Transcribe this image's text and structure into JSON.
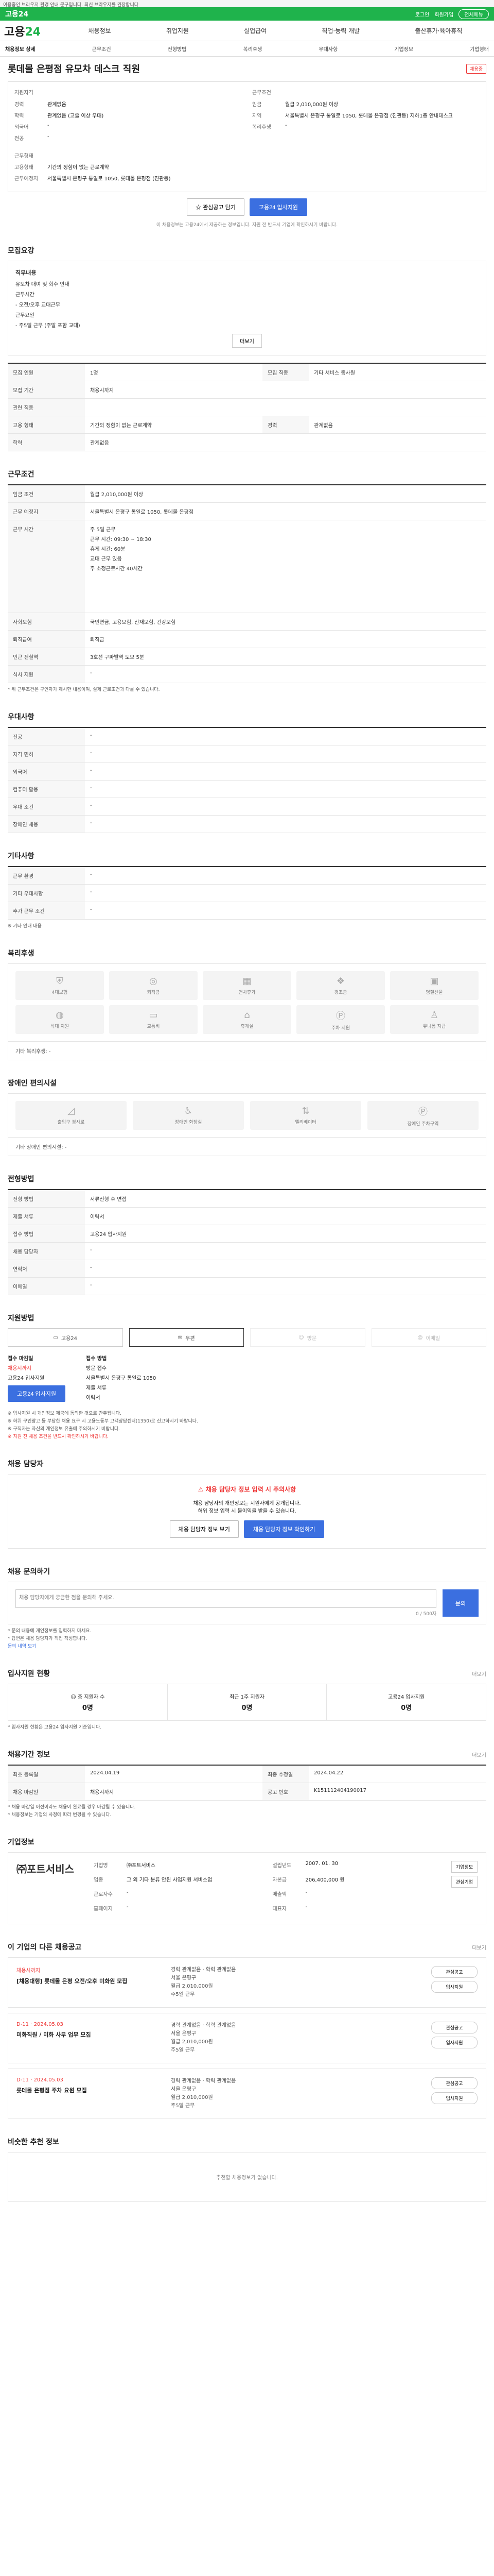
{
  "top_notice": "이용중인 브라우저 환경 안내 문구입니다. 최신 브라우저를 권장합니다",
  "gnb": {
    "logo": "고용24",
    "links": [
      "로그인",
      "회원가입",
      "전체메뉴"
    ]
  },
  "header": {
    "brand_a": "고용",
    "brand_b": "24",
    "nav": [
      "채용정보",
      "취업지원",
      "실업급여",
      "직업·능력 개발",
      "출산휴가·육아휴직"
    ]
  },
  "subnav": [
    "채용정보 상세",
    "근무조건",
    "전형방법",
    "복리후생",
    "우대사항",
    "기업정보",
    "기업형태"
  ],
  "job": {
    "title": "롯데몰 은평점 유모차 데스크 직원",
    "status_badge": "채용중",
    "summary_left_head": "지원자격",
    "summary_left": [
      {
        "k": "경력",
        "v": "관계없음"
      },
      {
        "k": "학력",
        "v": "관계없음 (고졸 이상 우대)"
      },
      {
        "k": "외국어",
        "v": "-"
      },
      {
        "k": "전공",
        "v": "-"
      }
    ],
    "summary_left2": [
      {
        "k": "근무형태",
        "v": ""
      },
      {
        "k": "고용형태",
        "v": "기간의 정함이 없는 근로계약"
      },
      {
        "k": "근무예정지",
        "v": "서울특별시 은평구 통일로 1050, 롯데몰 은평점 (진관동)"
      }
    ],
    "summary_right_head": "근무조건",
    "summary_right": [
      {
        "k": "임금",
        "v": "월급 2,010,000원 이상"
      },
      {
        "k": "지역",
        "v": "서울특별시 은평구 통일로 1050, 롯데몰 은평점 (진관동) 지하1층 안내데스크"
      },
      {
        "k": "복리후생",
        "v": "-"
      }
    ],
    "btn_interest": "관심공고 담기",
    "btn_apply": "고용24 입사지원",
    "notice": "이 채용정보는 고용24에서 제공하는 정보입니다. 지원 전 반드시 기업에 확인하시기 바랍니다."
  },
  "recruit": {
    "section": "모집요강",
    "head": "직무내용",
    "lines": [
      "유모차 대여 및 회수 안내",
      "",
      "근무시간",
      "- 오전/오후 교대근무",
      "",
      "근무요일",
      "- 주5일 근무 (주말 포함 교대)"
    ],
    "more": "더보기"
  },
  "detail_rows": [
    {
      "th": "모집 인원",
      "td": "1명",
      "th2": "모집 직종",
      "td2": "기타 서비스 종사원"
    },
    {
      "th": "모집 기간",
      "td": "채용시까지",
      "th2": "",
      "td2": ""
    },
    {
      "th": "관련 직종",
      "td": "",
      "th2": "",
      "td2": ""
    },
    {
      "th": "고용 형태",
      "td": "기간의 정함이 없는 근로계약",
      "th2": "경력",
      "td2": "관계없음"
    },
    {
      "th": "학력",
      "td": "관계없음",
      "th2": "",
      "td2": ""
    }
  ],
  "conditions": {
    "section": "근무조건",
    "wage_th": "임금 조건",
    "wage": "월급 2,010,000원 이상",
    "area_th": "근무 예정지",
    "area": "서울특별시 은평구 통일로 1050, 롯데몰 은평점",
    "time_th": "근무 시간",
    "time_lines": [
      "주 5일 근무",
      "근무 시간: 09:30 ~ 18:30",
      "휴게 시간: 60분",
      "교대 근무 있음",
      "주 소정근로시간 40시간"
    ],
    "insurance_th": "사회보험",
    "insurance": "국민연금, 고용보험, 산재보험, 건강보험",
    "retire_th": "퇴직급여",
    "retire": "퇴직금",
    "subway_th": "인근 전철역",
    "subway": "3호선 구파발역 도보 5분",
    "food_th": "식사 지원",
    "food": "-",
    "note": "* 위 근무조건은 구인자가 제시한 내용이며, 실제 근로조건과 다를 수 있습니다."
  },
  "qualifications": {
    "section": "우대사항",
    "rows": [
      {
        "th": "전공",
        "td": "-"
      },
      {
        "th": "자격 면허",
        "td": "-"
      },
      {
        "th": "외국어",
        "td": "-"
      },
      {
        "th": "컴퓨터 활용",
        "td": "-"
      },
      {
        "th": "우대 조건",
        "td": "-"
      },
      {
        "th": "장애인 채용",
        "td": "-"
      }
    ]
  },
  "etc": {
    "section": "기타사항",
    "rows": [
      {
        "th": "근무 환경",
        "td": "-"
      },
      {
        "th": "기타 우대사항",
        "td": "-"
      },
      {
        "th": "추가 근무 조건",
        "td": "-"
      }
    ],
    "note": "※ 기타 안내 내용"
  },
  "welfare": {
    "section": "복리후생",
    "items": [
      "4대보험",
      "퇴직금",
      "연차휴가",
      "경조금",
      "명절선물",
      "식대 지원",
      "교통비",
      "휴게실",
      "주차 지원",
      "유니폼 지급"
    ],
    "note": "기타 복리후생: -"
  },
  "disabled": {
    "section": "장애인 편의시설",
    "items": [
      "출입구 경사로",
      "장애인 화장실",
      "엘리베이터",
      "장애인 주차구역"
    ],
    "note": "기타 장애인 편의시설: -"
  },
  "selection": {
    "section": "전형방법",
    "rows": [
      {
        "th": "전형 방법",
        "td": "서류전형 후 면접"
      },
      {
        "th": "제출 서류",
        "td": "이력서"
      },
      {
        "th": "접수 방법",
        "td": "고용24 입사지원"
      },
      {
        "th": "채용 담당자",
        "td": "-"
      },
      {
        "th": "연락처",
        "td": "-"
      },
      {
        "th": "이메일",
        "td": "-"
      }
    ]
  },
  "apply": {
    "section": "지원방법",
    "methods": [
      "고용24",
      "우편",
      "방문",
      "이메일"
    ],
    "left_title": "접수 마감일",
    "left_lines": [
      "채용시까지",
      "고용24 입사지원"
    ],
    "left_btn": "고용24 입사지원",
    "right_title": "접수 방법",
    "right_lines": [
      "방문 접수",
      "서울특별시 은평구 통일로 1050",
      "",
      "제출 서류",
      "이력서"
    ],
    "bullets": [
      "※ 입사지원 시 개인정보 제공에 동의한 것으로 간주됩니다.",
      "※ 허위 구인광고 등 부당한 채용 요구 시 고용노동부 고객상담센터(1350)로 신고하시기 바랍니다.",
      "※ 구직자는 자신의 개인정보 유출에 주의하시기 바랍니다.",
      "※ 지원 전 채용 조건을 반드시 확인하시기 바랍니다."
    ]
  },
  "contact": {
    "section": "채용 담당자",
    "warn_title": "채용 담당자 정보 입력 시 주의사항",
    "warn_lines": [
      "채용 담당자의 개인정보는 지원자에게 공개됩니다.",
      "허위 정보 입력 시 불이익을 받을 수 있습니다."
    ],
    "btn1": "채용 담당자 정보 보기",
    "btn2": "채용 담당자 정보 확인하기"
  },
  "qa": {
    "section": "채용 문의하기",
    "placeholder": "채용 담당자에게 궁금한 점을 문의해 주세요.",
    "count": "0 / 500자",
    "send": "문의",
    "notes": [
      "* 문의 내용에 개인정보를 입력하지 마세요.",
      "* 답변은 채용 담당자가 직접 작성합니다."
    ],
    "link": "문의 내역 보기"
  },
  "status": {
    "section": "입사지원 현황",
    "more": "더보기",
    "stats": [
      {
        "label": "총 지원자 수",
        "val": "0명"
      },
      {
        "label": "최근 1주 지원자",
        "val": "0명"
      },
      {
        "label": "고용24 입사지원",
        "val": "0명"
      }
    ],
    "note": "* 입사지원 현황은 고용24 입사지원 기준입니다."
  },
  "period": {
    "section": "채용기간 정보",
    "more": "더보기",
    "rows": [
      {
        "th": "최초 등록일",
        "td": "2024.04.19",
        "th2": "최종 수정일",
        "td2": "2024.04.22"
      },
      {
        "th": "채용 마감일",
        "td": "채용시까지",
        "th2": "공고 번호",
        "td2": "K151112404190017"
      }
    ],
    "notes": [
      "* 채용 마감일 이전이라도 채용이 완료될 경우 마감될 수 있습니다.",
      "* 채용정보는 기업의 사정에 따라 변경될 수 있습니다."
    ]
  },
  "company": {
    "section": "기업정보",
    "name": "㈜포트서비스",
    "rows": [
      {
        "k": "기업명",
        "v": "㈜포트서비스"
      },
      {
        "k": "설립년도",
        "v": "2007. 01. 30"
      },
      {
        "k": "업종",
        "v": "그 외 기타 분류 안된 사업지원 서비스업"
      },
      {
        "k": "자본금",
        "v": "206,400,000 원"
      },
      {
        "k": "근로자수",
        "v": "-"
      },
      {
        "k": "매출액",
        "v": "-"
      },
      {
        "k": "홈페이지",
        "v": "-"
      },
      {
        "k": "대표자",
        "v": "-"
      }
    ],
    "btns": [
      "기업정보",
      "관심기업"
    ]
  },
  "other_jobs": {
    "section": "이 기업의 다른 채용공고",
    "more": "더보기",
    "cards": [
      {
        "date": "채용시까지",
        "title": "[채용대행] 롯데몰 은평 오전/오후 미화원 모집",
        "mid": [
          "경력 관계없음 · 학력 관계없음",
          "서울 은평구",
          "월급 2,010,000원",
          "주5일 근무"
        ],
        "btns": [
          "관심공고",
          "입사지원"
        ]
      },
      {
        "date": "D-11 · 2024.05.03",
        "title": "미화직원 / 미화 사무 업무 모집",
        "mid": [
          "경력 관계없음 · 학력 관계없음",
          "서울 은평구",
          "월급 2,010,000원",
          "주5일 근무"
        ],
        "btns": [
          "관심공고",
          "입사지원"
        ]
      },
      {
        "date": "D-11 · 2024.05.03",
        "title": "롯데몰 은평점 주차 요원 모집",
        "mid": [
          "경력 관계없음 · 학력 관계없음",
          "서울 은평구",
          "월급 2,010,000원",
          "주5일 근무"
        ],
        "btns": [
          "관심공고",
          "입사지원"
        ]
      }
    ]
  },
  "similar": {
    "section": "비슷한 추천 정보",
    "empty": "추천할 채용정보가 없습니다."
  },
  "colors": {
    "brand": "#1fb34c",
    "primary": "#3b6fe0",
    "alert": "#e33333"
  }
}
